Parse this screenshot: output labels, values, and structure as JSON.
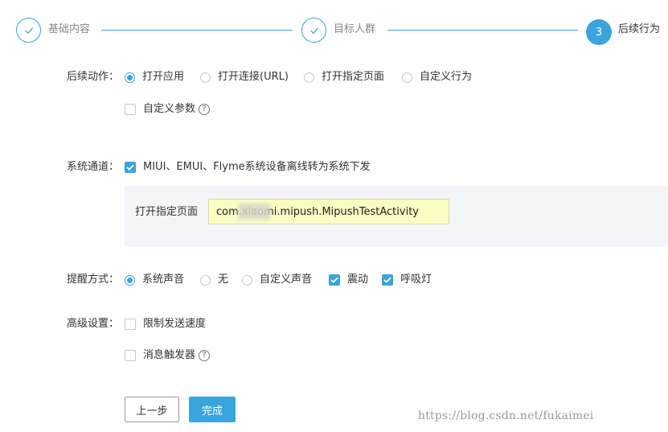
{
  "colors": {
    "accent": "#3aa4dc",
    "panel_bg": "#f3f5f8",
    "input_bg": "#fbfcc3"
  },
  "stepper": {
    "steps": [
      {
        "label": "基础内容",
        "state": "done",
        "icon": "check-icon"
      },
      {
        "label": "目标人群",
        "state": "done",
        "icon": "check-icon"
      },
      {
        "label": "后续行为",
        "state": "active",
        "number": "3"
      }
    ]
  },
  "follow_action": {
    "label": "后续动作：",
    "options": [
      {
        "label": "打开应用",
        "checked": true
      },
      {
        "label": "打开连接(URL)",
        "checked": false
      },
      {
        "label": "打开指定页面",
        "checked": false
      },
      {
        "label": "自定义行为",
        "checked": false
      }
    ],
    "custom_params": {
      "label": "自定义参数",
      "checked": false,
      "help": "?"
    }
  },
  "system_channel": {
    "label": "系统通道：",
    "checkbox": {
      "label": "MIUI、EMUI、Flyme系统设备离线转为系统下发",
      "checked": true
    },
    "panel": {
      "label": "打开指定页面",
      "value": "com.xiaomi.mipush.MipushTestActivity"
    }
  },
  "reminder": {
    "label": "提醒方式：",
    "radios": [
      {
        "label": "系统声音",
        "checked": true
      },
      {
        "label": "无",
        "checked": false
      },
      {
        "label": "自定义声音",
        "checked": false
      }
    ],
    "checkboxes": [
      {
        "label": "震动",
        "checked": true
      },
      {
        "label": "呼吸灯",
        "checked": true
      }
    ]
  },
  "advanced": {
    "label": "高级设置：",
    "options": [
      {
        "label": "限制发送速度",
        "checked": false
      },
      {
        "label": "消息触发器",
        "checked": false,
        "help": "?"
      }
    ]
  },
  "buttons": {
    "prev": "上一步",
    "done": "完成"
  },
  "watermark": "https://blog.csdn.net/fukaimei"
}
